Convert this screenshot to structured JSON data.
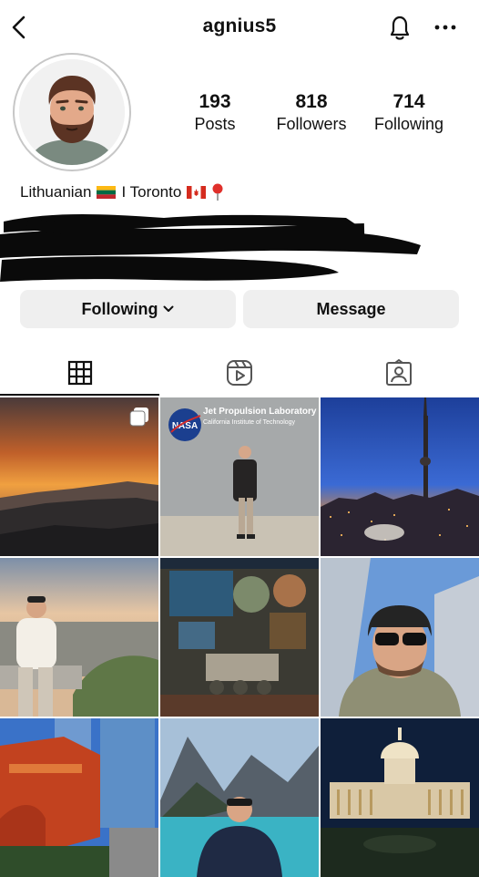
{
  "header": {
    "username": "agnius5"
  },
  "stats": [
    {
      "value": "193",
      "label": "Posts"
    },
    {
      "value": "818",
      "label": "Followers"
    },
    {
      "value": "714",
      "label": "Following"
    }
  ],
  "bio": {
    "text_before": "Lithuanian",
    "text_middle": "I Toronto"
  },
  "actions": {
    "following_label": "Following",
    "message_label": "Message"
  },
  "tabs": [
    {
      "icon": "grid-icon",
      "selected": true
    },
    {
      "icon": "reels-icon",
      "selected": false
    },
    {
      "icon": "tagged-icon",
      "selected": false
    }
  ],
  "posts": [
    {
      "subject": "mountain sunset",
      "multi": true
    },
    {
      "subject": "jet propulsion laboratory",
      "sign_title": "Jet Propulsion Laboratory",
      "sign_subtitle": "California Institute of Technology"
    },
    {
      "subject": "toronto skyline"
    },
    {
      "subject": "city overlook"
    },
    {
      "subject": "space museum"
    },
    {
      "subject": "selfie skyscrapers"
    },
    {
      "subject": "angels flight"
    },
    {
      "subject": "lake louise"
    },
    {
      "subject": "capitol at night"
    }
  ],
  "colors": {
    "accent": "#111111",
    "button_bg": "#efefef",
    "flag_lt": [
      "#fdb913",
      "#006a44",
      "#c1272d"
    ],
    "flag_ca": "#d52b1e"
  }
}
